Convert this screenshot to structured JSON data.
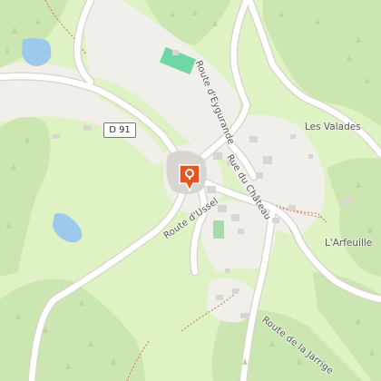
{
  "map": {
    "road_labels": {
      "d91": "D 91",
      "route_eygurande": "Route d'Eygurande",
      "rue_chateau": "Rue du Château",
      "route_ussel": "Route d'Ussel",
      "route_jarrige": "Route de la Jarrige"
    },
    "place_labels": {
      "les_valades": "Les Valades",
      "larfeuille": "L'Arfeuille"
    },
    "marker": {
      "icon": "map-pin-icon",
      "color": "#e8541f"
    },
    "colors": {
      "meadow": "#dff2c4",
      "forest": "#cbe6b0",
      "builtup": "#f1efea",
      "road": "#ffffff",
      "building": "#d9d6d2",
      "water": "#9cc9ec",
      "sport_pitch": "#6fd7a6",
      "path": "#c98a5a"
    }
  }
}
